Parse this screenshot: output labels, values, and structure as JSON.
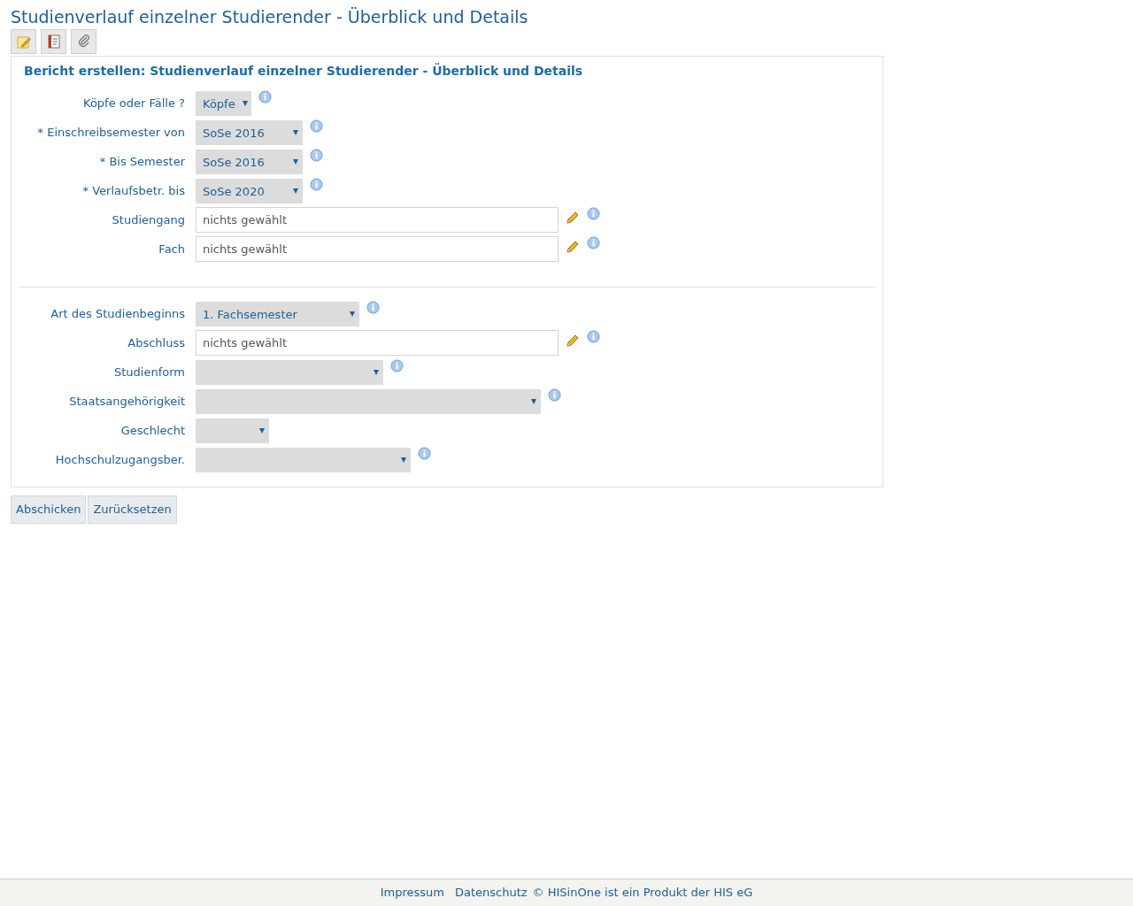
{
  "page_title": "Studienverlauf einzelner Studierender - Überblick und Details",
  "toolbar": [
    {
      "kind": "note"
    },
    {
      "kind": "list"
    },
    {
      "kind": "clip"
    }
  ],
  "form": {
    "heading": "Bericht erstellen: Studienverlauf einzelner Studierender - Überblick und Details",
    "sections": [
      {
        "fields": [
          {
            "label": "Köpfe oder Fälle ?",
            "kind": "select",
            "value": "Köpfe"
          },
          {
            "label": "* Einschreibsemester von",
            "kind": "select",
            "value": "SoSe 2016"
          },
          {
            "label": "* Bis Semester",
            "kind": "select",
            "value": "SoSe 2016"
          },
          {
            "label": "* Verlaufsbetr. bis",
            "kind": "select",
            "value": "SoSe 2020"
          },
          {
            "label": "Studiengang",
            "kind": "picker",
            "placeholder": "nichts gewählt"
          },
          {
            "label": "Fach",
            "kind": "picker",
            "placeholder": "nichts gewählt"
          }
        ]
      },
      {
        "fields": [
          {
            "label": "Art des Studienbeginns",
            "kind": "select",
            "value": "1. Fachsemester"
          },
          {
            "label": "Abschluss",
            "kind": "picker",
            "placeholder": "nichts gewählt"
          },
          {
            "label": "Studienform",
            "kind": "select"
          },
          {
            "label": "Staatsangehörigkeit",
            "kind": "select"
          },
          {
            "label": "Geschlecht",
            "kind": "select",
            "info": false
          },
          {
            "label": "Hochschulzugangsber.",
            "kind": "select"
          }
        ]
      }
    ]
  },
  "buttons": [
    "Abschicken",
    "Zurücksetzen"
  ],
  "footer": {
    "links": [
      "Impressum",
      "Datenschutz"
    ],
    "copyright": "© HISinOne ist ein Produkt der HIS eG"
  }
}
